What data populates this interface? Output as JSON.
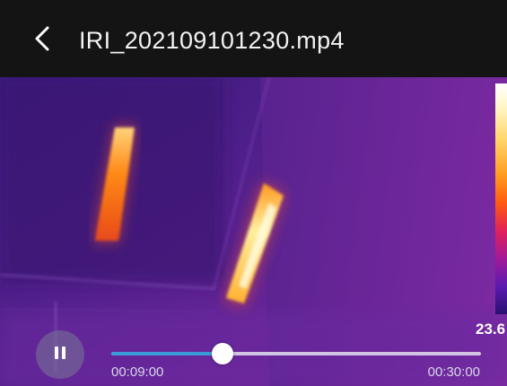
{
  "header": {
    "file_name": "IRI_202109101230.mp4",
    "back_icon": "chevron-left-icon"
  },
  "thermal_view": {
    "palette": "ironbow",
    "scale_min_label": "23.6",
    "colors": {
      "background": "#4a1e78",
      "hot_spot": "#ff7a10",
      "hottest": "#fff2a0"
    }
  },
  "player": {
    "play_icon": "pause-icon",
    "current_time": "00:09:00",
    "total_time": "00:30:00",
    "progress": 0.3,
    "accent_color": "#3a9bd8"
  }
}
